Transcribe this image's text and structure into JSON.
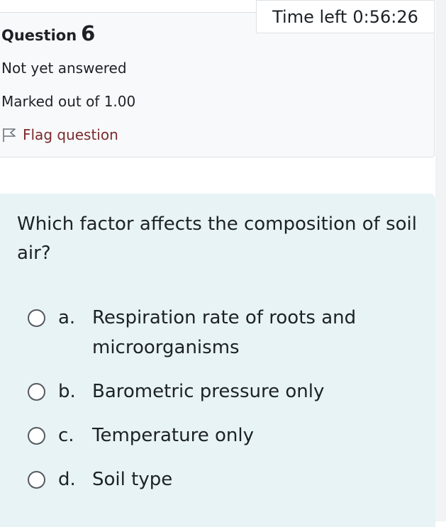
{
  "timer": {
    "label": "Time left",
    "value": "0:56:26"
  },
  "question_info": {
    "title": "Question",
    "number": "6",
    "state": "Not yet answered",
    "grade": "Marked out of 1.00",
    "flag_label": "Flag question",
    "flag_icon": "flag-icon"
  },
  "question": {
    "text": "Which factor affects the composition of soil air?",
    "answers": [
      {
        "letter": "a.",
        "text": "Respiration rate of roots and microorganisms"
      },
      {
        "letter": "b.",
        "text": "Barometric pressure only"
      },
      {
        "letter": "c.",
        "text": "Temperature only"
      },
      {
        "letter": "d.",
        "text": "Soil type"
      }
    ]
  },
  "colors": {
    "info_background": "#f8f9fa",
    "content_background": "#e7f3f5",
    "flag_text": "#7a2b2b"
  }
}
